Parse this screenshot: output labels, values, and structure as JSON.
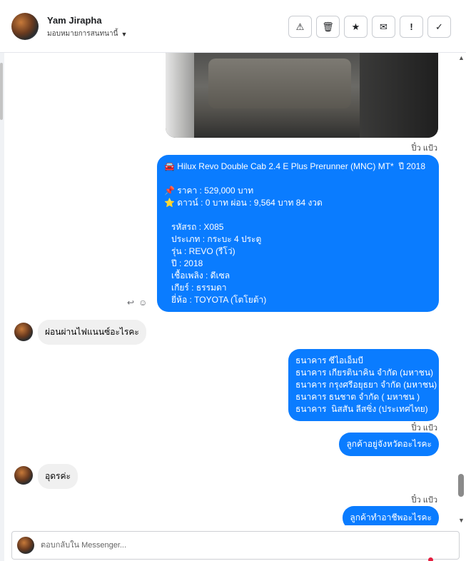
{
  "header": {
    "contact_name": "Yam Jirapha",
    "assign_label": "มอบหมายการสนทนานี้",
    "actions": [
      {
        "name": "spam-button",
        "glyph": "⚠"
      },
      {
        "name": "delete-button",
        "glyph": "🗑"
      },
      {
        "name": "star-button",
        "glyph": "★"
      },
      {
        "name": "mark-unread-button",
        "glyph": "✉"
      },
      {
        "name": "follow-up-button",
        "glyph": "!"
      },
      {
        "name": "done-button",
        "glyph": "✓"
      }
    ]
  },
  "messages": {
    "seen_label": "ปิ๋ว แป้ว",
    "car_info": [
      "🚘 Hilux Revo Double Cab 2.4 E Plus Prerunner (MNC) MT*  ปี 2018",
      "",
      "📌 ราคา : 529,000 บาท",
      "⭐ ดาวน์ : 0 บาท ผ่อน : 9,564 บาท 84 งวด",
      "",
      "   รหัสรถ : X085",
      "   ประเภท : กระบะ 4 ประตู",
      "   รุ่น : REVO (รีโว่)",
      "   ปี : 2018",
      "   เชื้อเพลิง : ดีเซล",
      "   เกียร์ : ธรรมดา",
      "   ยี่ห้อ : TOYOTA (โตโยต้า)"
    ],
    "incoming_1": "ผ่อนผ่านไฟแนนซ์อะไรคะ",
    "banks": [
      "ธนาคาร ซีไอเอ็มบี",
      "ธนาคาร เกียรตินาคิน จำกัด (มหาชน)",
      "ธนาคาร กรุงศรีอยุธยา จำกัด (มหาชน)",
      "ธนาคาร ธนชาต จำกัด ( มหาชน )",
      "ธนาคาร  นิสสัน ลีสซิ่ง (ประเทศไทย)"
    ],
    "outgoing_province": "ลูกค้าอยู่จังหวัดอะไรคะ",
    "incoming_2": "อุดรค่ะ",
    "outgoing_job": "ลูกค้าทำอาชีพอะไรคะ"
  },
  "composer": {
    "placeholder": "ตอบกลับใน Messenger..."
  },
  "colors": {
    "outgoing_bubble": "#0a7cff",
    "incoming_bubble": "#f0f0f0",
    "notification_dot": "#e41e3f"
  }
}
